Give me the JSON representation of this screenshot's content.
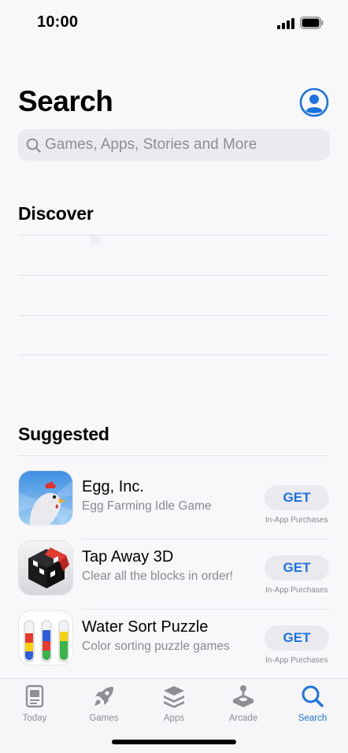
{
  "status_bar": {
    "time": "10:00"
  },
  "header": {
    "title": "Search"
  },
  "search": {
    "placeholder": "Games, Apps, Stories and More"
  },
  "discover": {
    "title": "Discover",
    "items": [
      "",
      "",
      ""
    ]
  },
  "suggested": {
    "title": "Suggested",
    "apps": [
      {
        "name": "Egg, Inc.",
        "subtitle": "Egg Farming Idle Game",
        "button": "GET",
        "note": "In-App Purchases",
        "icon": "egg-inc-chicken-icon"
      },
      {
        "name": "Tap Away 3D",
        "subtitle": "Clear all the blocks in order!",
        "button": "GET",
        "note": "In-App Purchases",
        "icon": "tap-away-cube-icon"
      },
      {
        "name": "Water Sort Puzzle",
        "subtitle": "Color sorting puzzle games",
        "button": "GET",
        "note": "In-App Purchases",
        "icon": "water-sort-tubes-icon"
      }
    ]
  },
  "tab_bar": {
    "tabs": [
      {
        "label": "Today",
        "icon": "today-icon"
      },
      {
        "label": "Games",
        "icon": "rocket-icon"
      },
      {
        "label": "Apps",
        "icon": "stack-icon"
      },
      {
        "label": "Arcade",
        "icon": "joystick-icon"
      },
      {
        "label": "Search",
        "icon": "search-icon",
        "active": true
      }
    ]
  },
  "colors": {
    "accent": "#1a73e0",
    "background": "#f8f8fa",
    "secondary_text": "#8a8a8f"
  }
}
